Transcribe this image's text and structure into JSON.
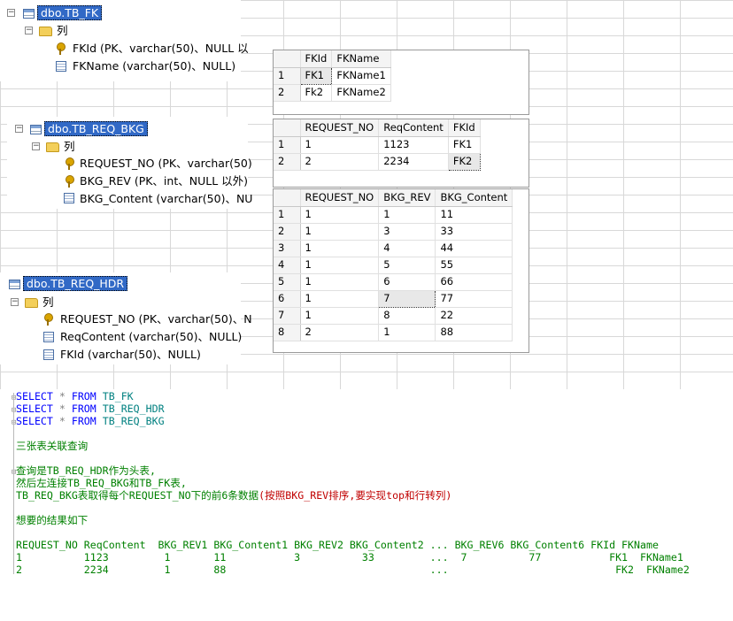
{
  "tree1": {
    "table": "dbo.TB_FK",
    "folder": "列",
    "cols": [
      "FKId (PK、varchar(50)、NULL 以",
      "FKName (varchar(50)、NULL)"
    ]
  },
  "tree2": {
    "table": "dbo.TB_REQ_BKG",
    "folder": "列",
    "cols": [
      "REQUEST_NO (PK、varchar(50)",
      "BKG_REV (PK、int、NULL 以外)",
      "BKG_Content (varchar(50)、NU"
    ]
  },
  "tree3": {
    "table": "dbo.TB_REQ_HDR",
    "folder": "列",
    "cols": [
      "REQUEST_NO (PK、varchar(50)、N",
      "ReqContent (varchar(50)、NULL)",
      "FKId (varchar(50)、NULL)"
    ]
  },
  "grid1": {
    "headers": [
      "FKId",
      "FKName"
    ],
    "rows": [
      [
        "1",
        "FK1",
        "FKName1"
      ],
      [
        "2",
        "Fk2",
        "FKName2"
      ]
    ]
  },
  "grid2": {
    "headers": [
      "REQUEST_NO",
      "ReqContent",
      "FKId"
    ],
    "rows": [
      [
        "1",
        "1",
        "1123",
        "FK1"
      ],
      [
        "2",
        "2",
        "2234",
        "FK2"
      ]
    ]
  },
  "grid3": {
    "headers": [
      "REQUEST_NO",
      "BKG_REV",
      "BKG_Content"
    ],
    "rows": [
      [
        "1",
        "1",
        "1",
        "11"
      ],
      [
        "2",
        "1",
        "3",
        "33"
      ],
      [
        "3",
        "1",
        "4",
        "44"
      ],
      [
        "4",
        "1",
        "5",
        "55"
      ],
      [
        "5",
        "1",
        "6",
        "66"
      ],
      [
        "6",
        "1",
        "7",
        "77"
      ],
      [
        "7",
        "1",
        "8",
        "22"
      ],
      [
        "8",
        "2",
        "1",
        "88"
      ]
    ]
  },
  "sql": {
    "l1": {
      "kw": "SELECT",
      "star": "*",
      "from": "FROM",
      "tbl": "TB_FK"
    },
    "l2": {
      "kw": "SELECT",
      "star": "*",
      "from": "FROM",
      "tbl": "TB_REQ_HDR"
    },
    "l3": {
      "kw": "SELECT",
      "star": "*",
      "from": "FROM",
      "tbl": "TB_REQ_BKG"
    },
    "c1": "三张表关联查询",
    "c2": "查询是TB_REQ_HDR作为头表,",
    "c3": "然后左连接TB_REQ_BKG和TB_FK表,",
    "c4a": "TB_REQ_BKG表取得每个REQUEST_NO下的前6条数据",
    "c4b": "(按照BKG_REV排序,要实现top和行转列)",
    "c5": "想要的结果如下",
    "r_head": "REQUEST_NO ReqContent  BKG_REV1 BKG_Content1 BKG_REV2 BKG_Content2 ... BKG_REV6 BKG_Content6 FKId FKName",
    "r1": "1          1123         1       11           3          33         ...  7          77           FK1  FKName1",
    "r2": "2          2234         1       88                                 ...                           FK2  FKName2"
  }
}
